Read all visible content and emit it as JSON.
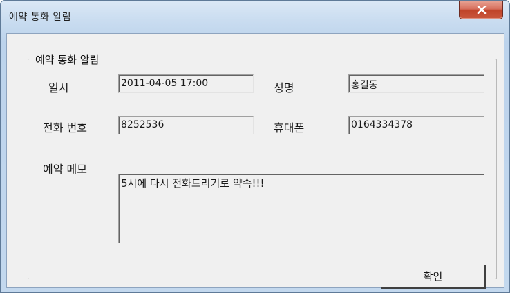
{
  "window": {
    "title": "예약 통화 알림",
    "close_glyph": "x"
  },
  "group": {
    "legend": "예약 통화 알림"
  },
  "fields": {
    "datetime_label": "일시",
    "datetime_value": "2011-04-05 17:00",
    "name_label": "성명",
    "name_value": "홍길동",
    "phone_label": "전화 번호",
    "phone_value": "8252536",
    "mobile_label": "휴대폰",
    "mobile_value": "0164334378",
    "memo_label": "예약 메모",
    "memo_value": "5시에 다시 전화드리기로 약속!!!"
  },
  "buttons": {
    "ok_label": "확인"
  },
  "icons": {
    "close": "close-icon"
  },
  "colors": {
    "close_button": "#c9573d",
    "dialog_face": "#f0f0f0",
    "frame": "#c3d8ee"
  }
}
